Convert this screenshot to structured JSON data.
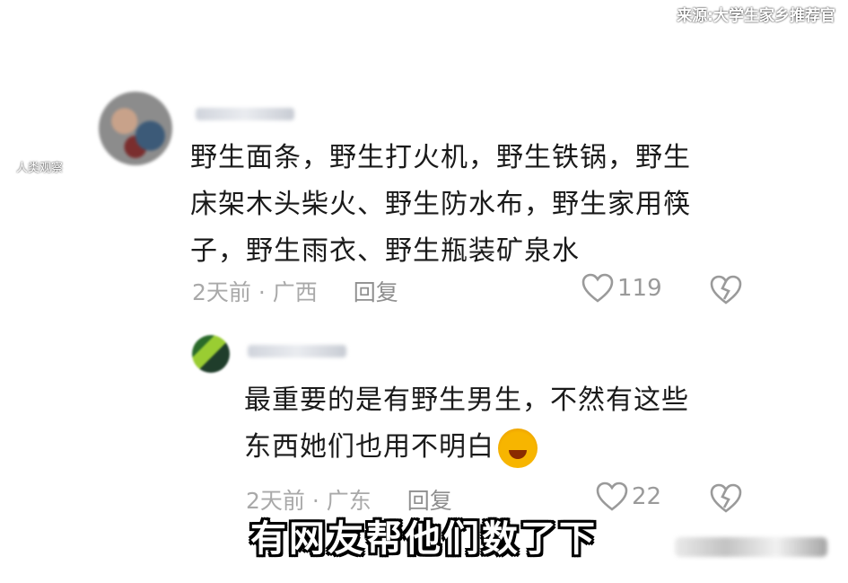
{
  "source_label": "来源:大学生家乡推荐官",
  "side_label": "人类观察",
  "comments": [
    {
      "text_lines": [
        "野生面条，野生打火机，野生铁锅，野生",
        "床架木头柴火、野生防水布，野生家用筷",
        "子，野生雨衣、野生瓶装矿泉水"
      ],
      "time_location": "2天前 · 广西",
      "reply_label": "回复",
      "likes": "119",
      "icons": [
        "heart-outline-icon",
        "broken-heart-icon"
      ]
    },
    {
      "text_lines": [
        "最重要的是有野生男生，不然有这些",
        "东西她们也用不明白"
      ],
      "emoji": "laughing-crying-emoji",
      "time_location": "2天前 · 广东",
      "reply_label": "回复",
      "likes": "22",
      "icons": [
        "heart-outline-icon",
        "broken-heart-icon"
      ]
    }
  ],
  "subtitle": "有网友帮他们数了下",
  "colors": {
    "background": "#050505",
    "grid": "#ffffff",
    "card": "#ffffff",
    "text": "#1a1a1a",
    "meta": "#a9a9a9"
  }
}
